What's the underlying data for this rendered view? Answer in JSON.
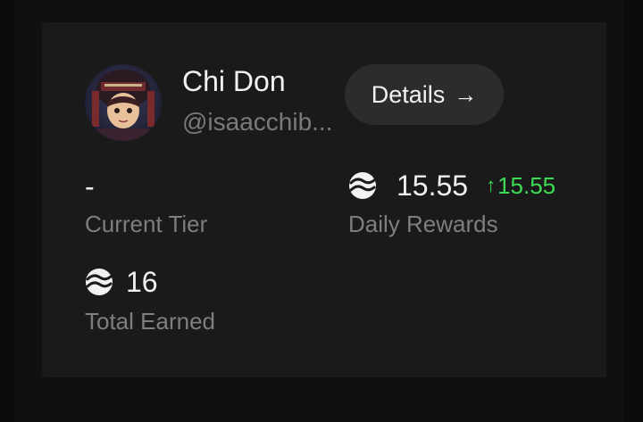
{
  "profile": {
    "name": "Chi Don",
    "handle": "@isaacchib..."
  },
  "details_button": {
    "label": "Details",
    "icon": "arrow-right-icon",
    "arrow_glyph": "→"
  },
  "stats": {
    "current_tier": {
      "value": "-",
      "label": "Current Tier"
    },
    "daily_rewards": {
      "value": "15.55",
      "delta": "15.55",
      "delta_arrow": "↑",
      "label": "Daily Rewards",
      "icon": "token-coin-icon"
    },
    "total_earned": {
      "value": "16",
      "label": "Total Earned",
      "icon": "token-coin-icon"
    }
  },
  "colors": {
    "background": "#0b0b0b",
    "card": "#1a1a1a",
    "button": "#2c2c2c",
    "text_primary": "#f2f2f2",
    "text_muted": "#7e7e7e",
    "positive": "#3ddc55"
  }
}
